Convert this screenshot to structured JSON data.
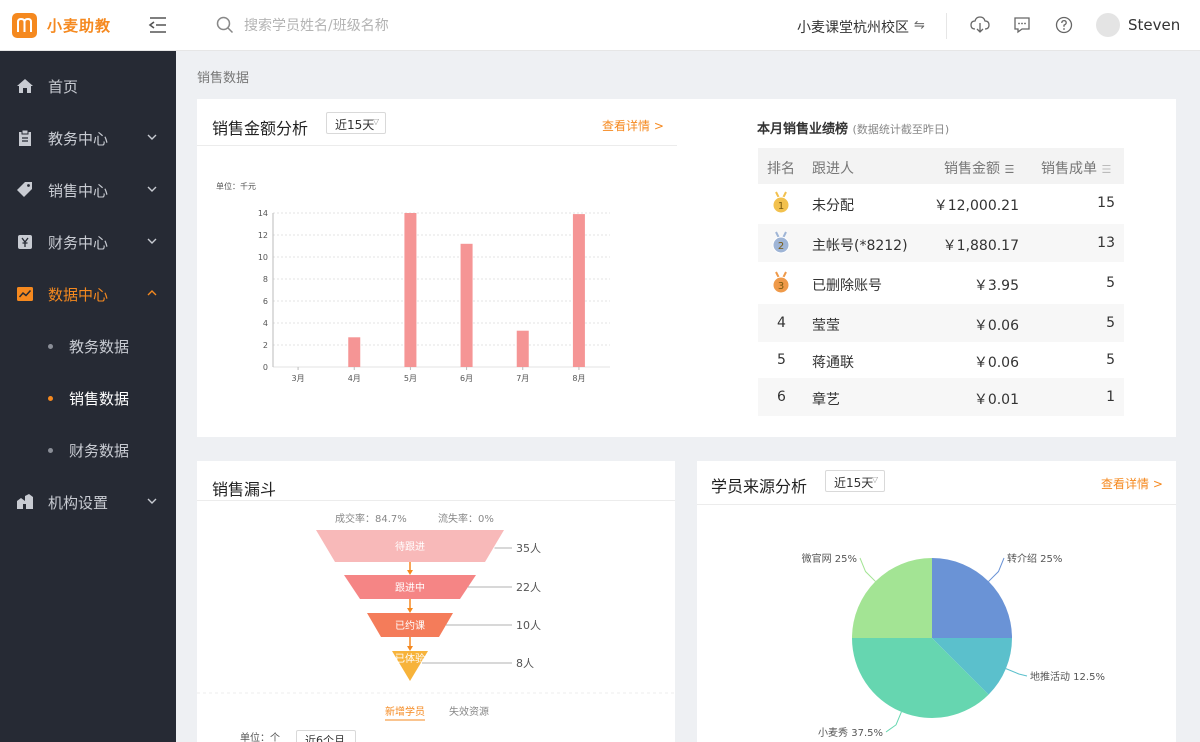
{
  "app": {
    "brand": "小麦助教"
  },
  "header": {
    "search_placeholder": "搜索学员姓名/班级名称",
    "campus": "小麦课堂杭州校区",
    "swap_glyph": "⇋",
    "username": "Steven"
  },
  "sidebar": {
    "items": [
      {
        "label": "首页",
        "icon": "home-icon"
      },
      {
        "label": "教务中心",
        "icon": "clipboard-icon"
      },
      {
        "label": "销售中心",
        "icon": "tag-icon"
      },
      {
        "label": "财务中心",
        "icon": "yen-icon"
      },
      {
        "label": "数据中心",
        "icon": "chart-icon"
      },
      {
        "label": "机构设置",
        "icon": "building-icon"
      }
    ],
    "sub_items": [
      {
        "label": "教务数据"
      },
      {
        "label": "销售数据"
      },
      {
        "label": "财务数据"
      }
    ],
    "accent": "#f5891f"
  },
  "breadcrumb": "销售数据",
  "sales_amount": {
    "title": "销售金额分析",
    "range": "近15天",
    "detail_link": "查看详情 >",
    "unit": "单位：千元"
  },
  "ranking": {
    "title": "本月销售业绩榜",
    "note": "(数据统计截至昨日)",
    "headers": {
      "rank": "排名",
      "name": "跟进人",
      "amount": "销售金额",
      "orders": "销售成单"
    },
    "rows": [
      {
        "rank": "1",
        "name": "未分配",
        "amount": "￥12,000.21",
        "orders": "15"
      },
      {
        "rank": "2",
        "name": "主帐号(*8212)",
        "amount": "￥1,880.17",
        "orders": "13"
      },
      {
        "rank": "3",
        "name": "已删除账号",
        "amount": "￥3.95",
        "orders": "5"
      },
      {
        "rank": "4",
        "name": "莹莹",
        "amount": "￥0.06",
        "orders": "5"
      },
      {
        "rank": "5",
        "name": "蒋通联",
        "amount": "￥0.06",
        "orders": "5"
      },
      {
        "rank": "6",
        "name": "章艺",
        "amount": "￥0.01",
        "orders": "1"
      }
    ]
  },
  "funnel": {
    "title": "销售漏斗",
    "conversion": "成交率：84.7%",
    "loss": "流失率：0%",
    "tabs": [
      "新增学员",
      "失效资源"
    ],
    "unit": "单位：个",
    "range": "近6个月",
    "stages": [
      {
        "name": "待跟进",
        "count": "35人",
        "color": "#f8b9b9"
      },
      {
        "name": "跟进中",
        "count": "22人",
        "color": "#f58585"
      },
      {
        "name": "已约课",
        "count": "10人",
        "color": "#f47c5a"
      },
      {
        "name": "已体验",
        "count": "8人",
        "color": "#f7b33a"
      }
    ]
  },
  "source": {
    "title": "学员来源分析",
    "range": "近15天",
    "detail_link": "查看详情 >"
  },
  "chart_data": [
    {
      "type": "bar",
      "categories": [
        "3月",
        "4月",
        "5月",
        "6月",
        "7月",
        "8月"
      ],
      "values": [
        0,
        2.7,
        14,
        11.2,
        3.3,
        13.9
      ],
      "title": "",
      "ylabel": "单位：千元",
      "ylim": [
        0,
        14
      ],
      "yticks": [
        "0",
        "2",
        "4",
        "6",
        "8",
        "10",
        "12",
        "14"
      ],
      "color": "#f59595",
      "grid": true
    },
    {
      "type": "pie",
      "categories": [
        "转介绍",
        "地推活动",
        "小麦秀",
        "微官网"
      ],
      "values": [
        25,
        12.5,
        37.5,
        25
      ],
      "labels": [
        "转介绍 25%",
        "地推活动 12.5%",
        "小麦秀 37.5%",
        "微官网 25%"
      ],
      "colors": [
        "#6a93d6",
        "#5bc0cc",
        "#66d6b0",
        "#a3e494"
      ]
    }
  ]
}
